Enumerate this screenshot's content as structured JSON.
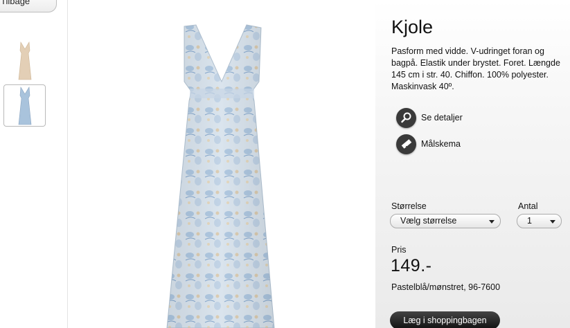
{
  "nav": {
    "back_label": "Tilbage"
  },
  "product": {
    "title": "Kjole",
    "description": "Pasform med vidde. V-udringet foran og\nbagpå. Elastik under brystet. Foret. Længde\n145 cm i str. 40. Chiffon. 100% polyester.\nMaskinvask 40º.",
    "links": [
      {
        "label": "Se detaljer",
        "icon": "magnifier-icon"
      },
      {
        "label": "Målskema",
        "icon": "measuring-tape-icon"
      }
    ],
    "size_label": "Størrelse",
    "size_value": "Vælg størrelse",
    "qty_label": "Antal",
    "qty_value": "1",
    "price_label": "Pris",
    "price": "149.-",
    "variant": "Pastelblå/mønstret, 96-7600",
    "cart_label": "Læg i shoppingbagen"
  },
  "colors": {
    "dress_blue": "#a9c3dc",
    "dress_beige": "#e3cfb6",
    "button_dark": "#222222"
  }
}
